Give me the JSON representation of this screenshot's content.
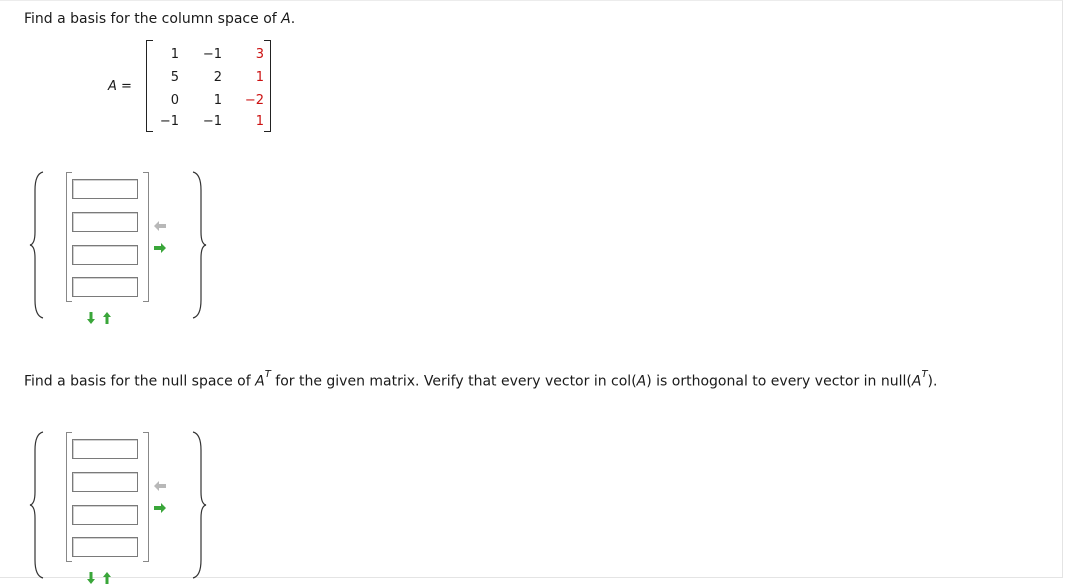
{
  "question1": {
    "text_before": "Find a basis for the column space of ",
    "var": "A",
    "text_after": "."
  },
  "matrix": {
    "label": "A =",
    "rows": [
      [
        "1",
        "−1",
        "3"
      ],
      [
        "5",
        "2",
        "1"
      ],
      [
        "0",
        "1",
        "−2"
      ],
      [
        "−1",
        "−1",
        "1"
      ]
    ],
    "highlight_color": "#cc1111"
  },
  "question2": {
    "t1": "Find a basis for the null space of ",
    "v1": "A",
    "sup1": "T",
    "t2": " for the given matrix. Verify that every vector in col(",
    "v2": "A",
    "t3": ") is orthogonal to every vector in null(",
    "v3": "A",
    "sup2": "T",
    "t4": ")."
  },
  "answer_groups": [
    {
      "fields": [
        "",
        "",
        "",
        ""
      ]
    },
    {
      "fields": [
        "",
        "",
        "",
        ""
      ]
    }
  ],
  "icons": {
    "remove_column": "arrow-left-icon",
    "add_column": "arrow-right-icon",
    "remove_row": "arrow-down-icon",
    "add_row": "arrow-up-icon",
    "active_color": "#3aa63a",
    "inactive_color": "#b8b8b8"
  }
}
